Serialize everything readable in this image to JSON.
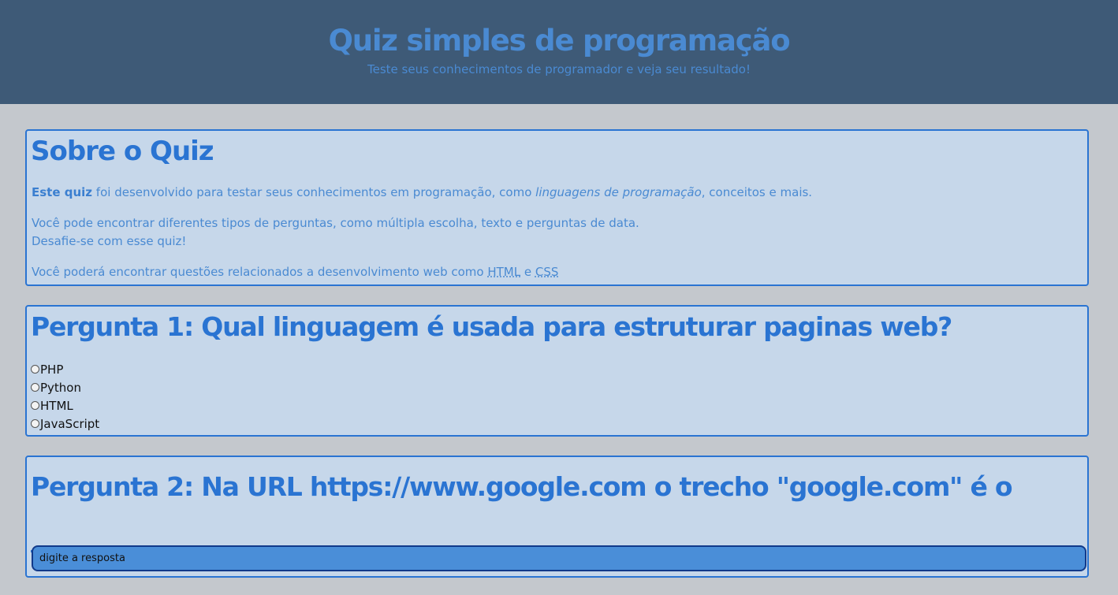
{
  "header": {
    "title": "Quiz simples de programação",
    "subtitle": "Teste seus conhecimentos de programador e veja seu resultado!"
  },
  "about": {
    "title": "Sobre o Quiz",
    "p1_bold": "Este quiz",
    "p1_a": " foi desenvolvido para testar seus conhecimentos em programação, como ",
    "p1_italic": "linguagens de programação",
    "p1_b": ", conceitos e mais.",
    "p2_line1": "Você pode encontrar diferentes tipos de perguntas, como múltipla escolha, texto e perguntas de data.",
    "p2_line2": "Desafie-se com esse quiz!",
    "p3_a": "Você poderá encontrar questões relacionados a desenvolvimento web como ",
    "p3_abbr1": "HTML",
    "p3_b": " e ",
    "p3_abbr2": "CSS"
  },
  "question1": {
    "title": "Pergunta 1: Qual linguagem é usada para estruturar paginas web?",
    "options": [
      "PHP",
      "Python",
      "HTML",
      "JavaScript"
    ]
  },
  "question2": {
    "title": "Pergunta 2: Na URL https://www.google.com o trecho \"google.com\" é o _____",
    "input_placeholder": "digite a resposta"
  }
}
